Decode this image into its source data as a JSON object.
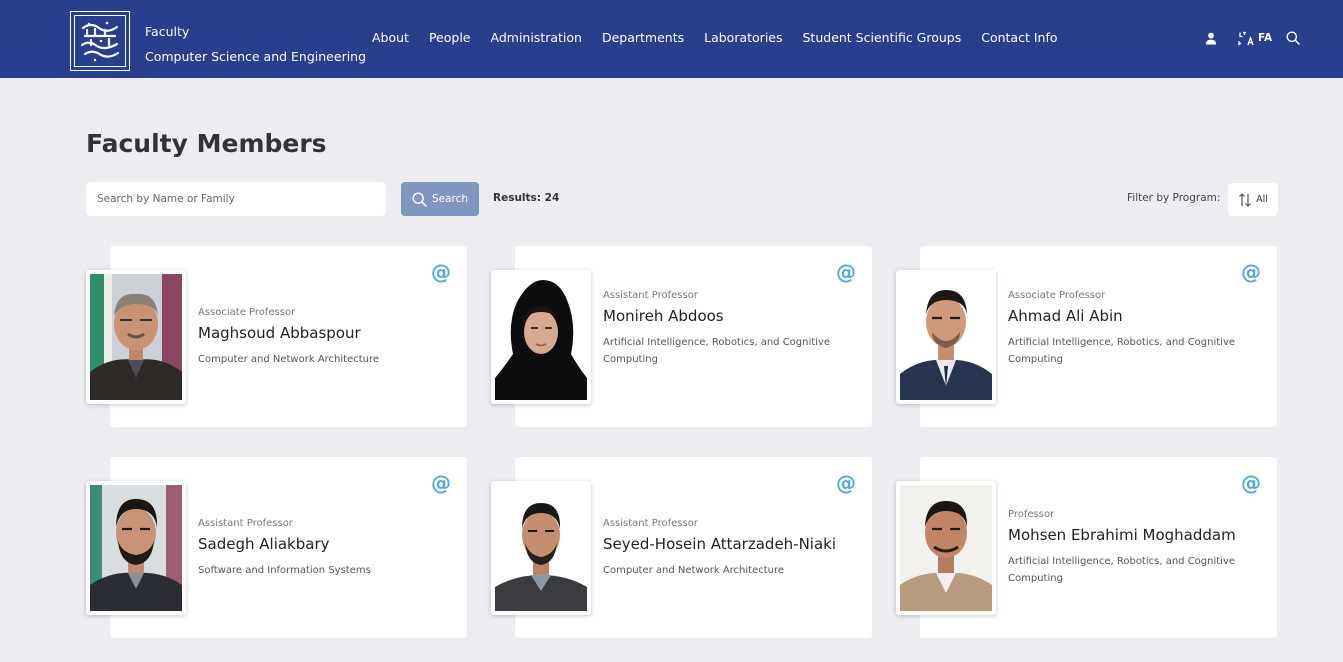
{
  "header": {
    "brand_line1": "Faculty",
    "brand_line2": "Computer Science and Engineering",
    "nav": [
      "About",
      "People",
      "Administration",
      "Departments",
      "Laboratories",
      "Student Scientific Groups",
      "Contact Info"
    ],
    "lang_label": "FA",
    "bg_color": "#283f8e"
  },
  "page": {
    "title": "Faculty Members",
    "search_placeholder": "Search by Name or Family",
    "search_value": "",
    "search_button": "Search",
    "results": "Results: 24",
    "filter_label": "Filter by Program:",
    "filter_value": "All"
  },
  "faculty": [
    {
      "rank": "Associate Professor",
      "name": "Maghsoud Abbaspour",
      "dept": "Computer and Network Architecture"
    },
    {
      "rank": "Assistant Professor",
      "name": "Monireh Abdoos",
      "dept": "Artificial Intelligence, Robotics, and Cognitive Computing"
    },
    {
      "rank": "Associate Professor",
      "name": "Ahmad Ali Abin",
      "dept": "Artificial Intelligence, Robotics, and Cognitive Computing"
    },
    {
      "rank": "Assistant Professor",
      "name": "Sadegh Aliakbary",
      "dept": "Software and Information Systems"
    },
    {
      "rank": "Assistant Professor",
      "name": "Seyed-Hosein Attarzadeh-Niaki",
      "dept": "Computer and Network Architecture"
    },
    {
      "rank": "Professor",
      "name": "Mohsen Ebrahimi Moghaddam",
      "dept": "Artificial Intelligence, Robotics, and Cognitive Computing"
    }
  ],
  "colors": {
    "accent": "#52a7dc",
    "search_button": "#7f97c1"
  }
}
